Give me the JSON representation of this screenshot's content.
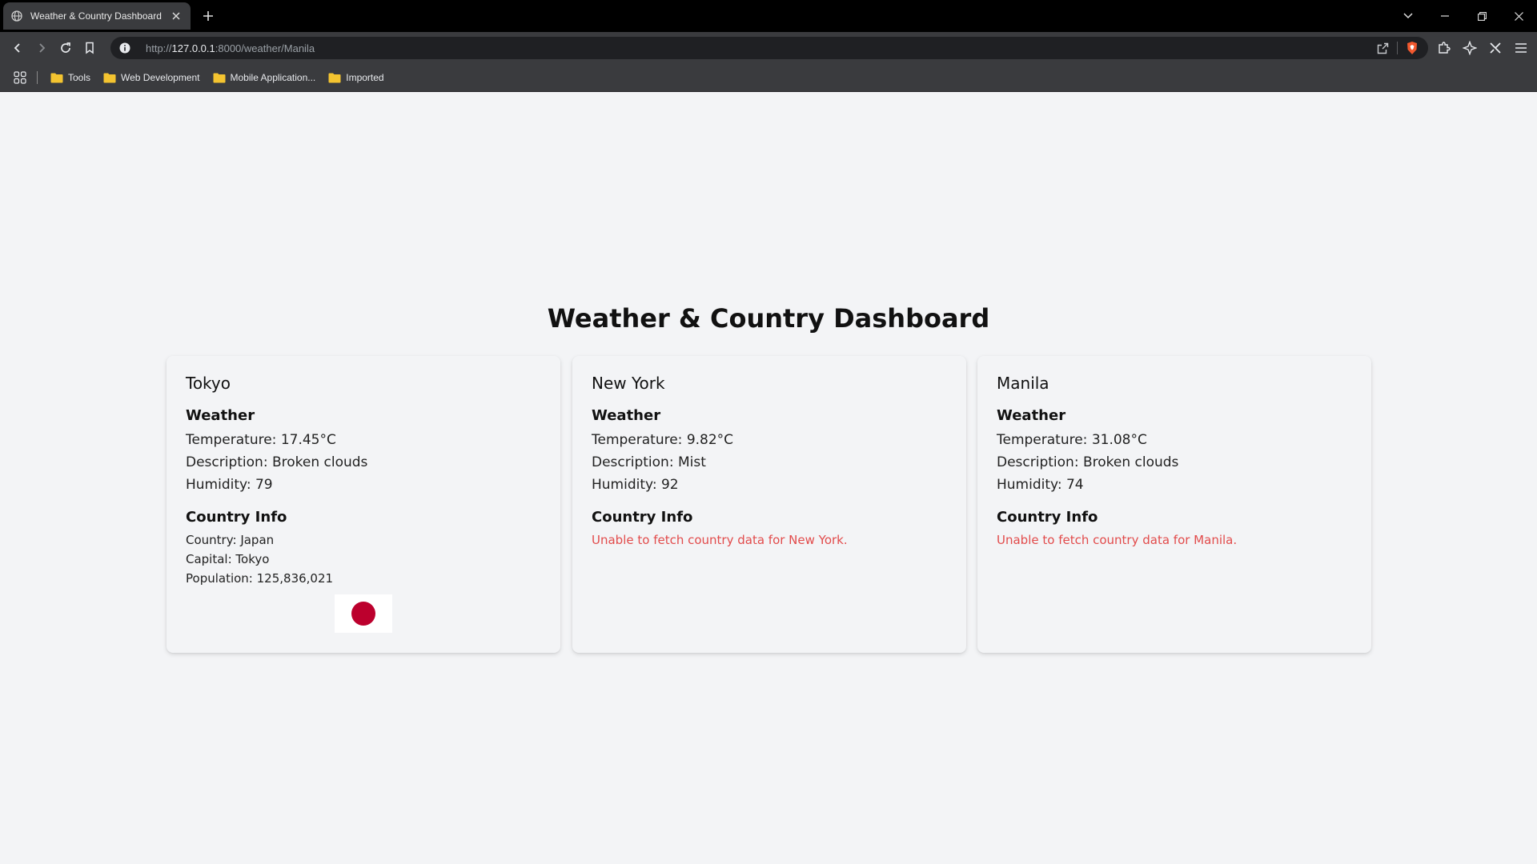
{
  "browser": {
    "tab_title": "Weather & Country Dashboard",
    "url_scheme": "http://",
    "url_host": "127.0.0.1",
    "url_path": ":8000/weather/Manila",
    "bookmarks": [
      {
        "label": "Tools"
      },
      {
        "label": "Web Development"
      },
      {
        "label": "Mobile Application..."
      },
      {
        "label": "Imported"
      }
    ]
  },
  "page": {
    "title": "Weather & Country Dashboard",
    "weather_heading": "Weather",
    "country_heading": "Country Info",
    "cards": [
      {
        "city": "Tokyo",
        "temperature": "Temperature: 17.45°C",
        "description": "Description: Broken clouds",
        "humidity": "Humidity: 79",
        "country": "Country: Japan",
        "capital": "Capital: Tokyo",
        "population": "Population: 125,836,021",
        "flag_color": "#bc002d"
      },
      {
        "city": "New York",
        "temperature": "Temperature: 9.82°C",
        "description": "Description: Mist",
        "humidity": "Humidity: 92",
        "error": "Unable to fetch country data for New York."
      },
      {
        "city": "Manila",
        "temperature": "Temperature: 31.08°C",
        "description": "Description: Broken clouds",
        "humidity": "Humidity: 74",
        "error": "Unable to fetch country data for Manila."
      }
    ]
  },
  "colors": {
    "error": "#e24b4b",
    "page_bg": "#f3f4f6",
    "chrome_bg": "#3a3b3e"
  }
}
